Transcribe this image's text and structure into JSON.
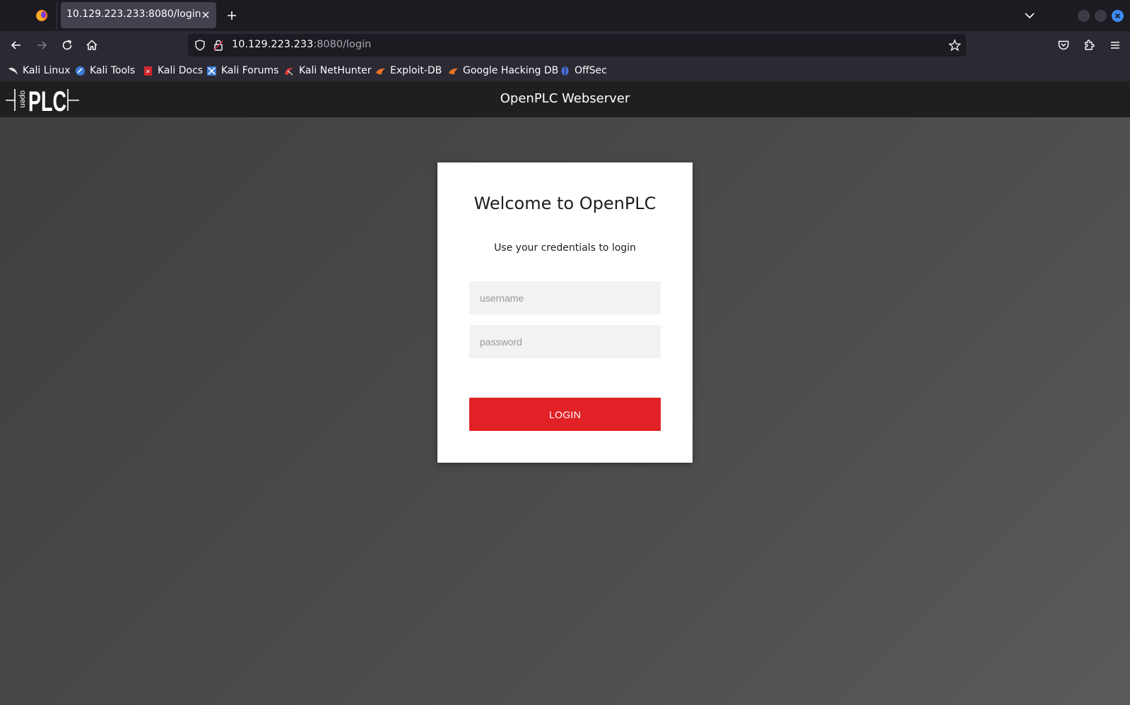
{
  "browser": {
    "tab_title": "10.129.223.233:8080/login",
    "url_host": "10.129.223.233",
    "url_rest": ":8080/login",
    "bookmarks": [
      {
        "label": "Kali Linux",
        "icon": "kali-dragon-icon",
        "color": "#d9d9d9"
      },
      {
        "label": "Kali Tools",
        "icon": "kali-tools-icon",
        "color": "#3d7bd8"
      },
      {
        "label": "Kali Docs",
        "icon": "kali-docs-icon",
        "color": "#d2262c"
      },
      {
        "label": "Kali Forums",
        "icon": "kali-forums-icon",
        "color": "#3d7bd8"
      },
      {
        "label": "Kali NetHunter",
        "icon": "nethunter-icon",
        "color": "#e03a3a"
      },
      {
        "label": "Exploit-DB",
        "icon": "exploit-db-icon",
        "color": "#e8722a"
      },
      {
        "label": "Google Hacking DB",
        "icon": "ghdb-icon",
        "color": "#e8722a"
      },
      {
        "label": "OffSec",
        "icon": "offsec-icon",
        "color": "#4a6fd8"
      }
    ]
  },
  "site": {
    "header_title": "OpenPLC Webserver",
    "logo_text": "PLC",
    "logo_small": "open"
  },
  "login": {
    "title": "Welcome to OpenPLC",
    "subtitle": "Use your credentials to login",
    "username_placeholder": "username",
    "password_placeholder": "password",
    "button_label": "LOGIN"
  },
  "colors": {
    "accent": "#e22126",
    "header_bg": "#1f1f1f"
  }
}
